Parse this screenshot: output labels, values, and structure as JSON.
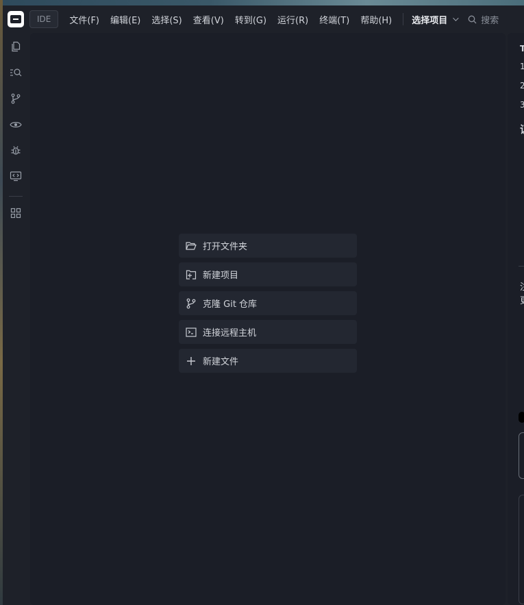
{
  "titlebar": {
    "product": "IDE",
    "menu": [
      "文件(F)",
      "编辑(E)",
      "选择(S)",
      "查看(V)",
      "转到(G)",
      "运行(R)",
      "终端(T)",
      "帮助(H)"
    ],
    "project_select": "选择项目",
    "search_label": "搜索"
  },
  "activity_bar": {
    "icons": [
      "explorer-icon",
      "search-icon",
      "source-control-icon",
      "preview-icon",
      "debug-icon",
      "remote-icon",
      "extensions-icon"
    ]
  },
  "start": {
    "items": [
      {
        "label": "打开文件夹",
        "icon": "folder-open-icon"
      },
      {
        "label": "新建项目",
        "icon": "new-project-icon"
      },
      {
        "label": "克隆 Git 仓库",
        "icon": "git-branch-icon"
      },
      {
        "label": "连接远程主机",
        "icon": "terminal-icon"
      },
      {
        "label": "新建文件",
        "icon": "plus-icon"
      }
    ]
  },
  "right_panel": {
    "lines": [
      "T",
      "1",
      "2",
      "3",
      "证",
      "注",
      "更"
    ]
  },
  "colors": {
    "background": "#1b1e27",
    "chrome": "#1e2129",
    "button": "#232731",
    "text": "#d2d5db"
  }
}
